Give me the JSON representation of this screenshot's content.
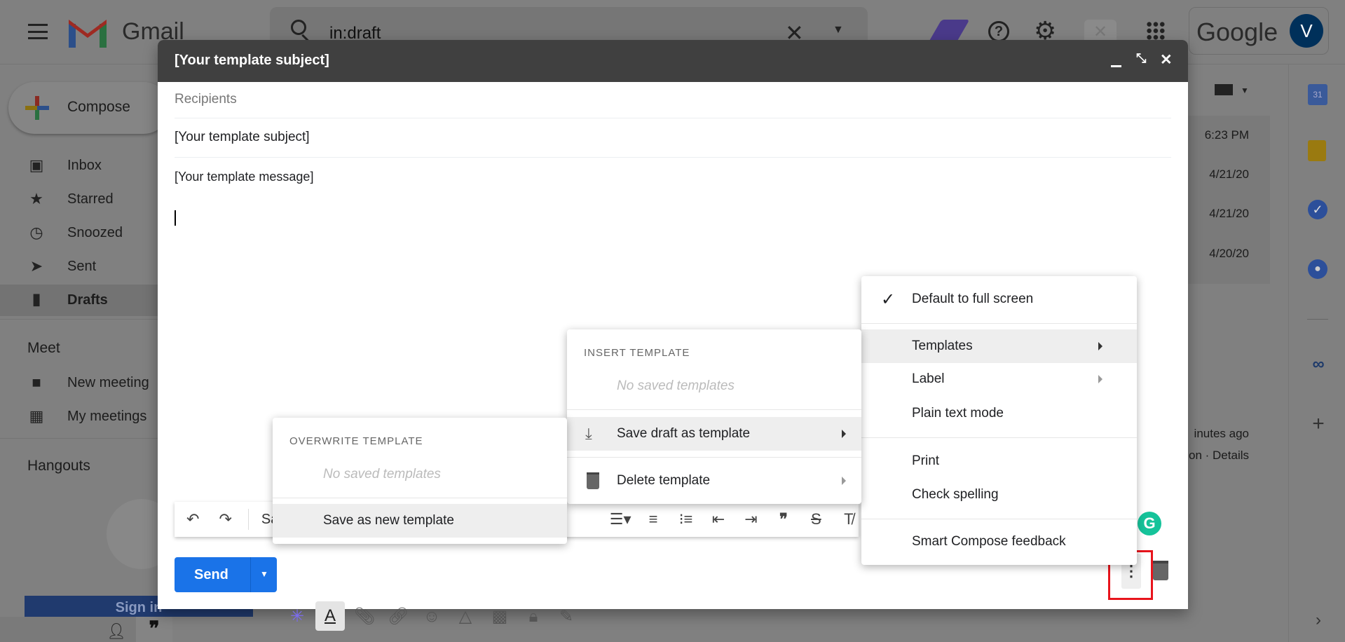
{
  "header": {
    "app_name": "Gmail",
    "search_value": "in:draft",
    "google_label": "Google",
    "avatar_letter": "V"
  },
  "sidebar": {
    "compose_label": "Compose",
    "items": [
      {
        "label": "Inbox"
      },
      {
        "label": "Starred"
      },
      {
        "label": "Snoozed"
      },
      {
        "label": "Sent"
      },
      {
        "label": "Drafts",
        "selected": true
      }
    ],
    "meet_heading": "Meet",
    "meet_items": [
      {
        "label": "New meeting"
      },
      {
        "label": "My meetings"
      }
    ],
    "hangouts_heading": "Hangouts",
    "sign_in_label": "Sign in"
  },
  "list": {
    "dates": [
      "6:23 PM",
      "4/21/20",
      "4/21/20",
      "4/20/20"
    ],
    "activity": "inutes ago",
    "details": "on · Details"
  },
  "compose": {
    "title": "[Your template subject]",
    "recipients_placeholder": "Recipients",
    "subject": "[Your template subject]",
    "body": "[Your template message]",
    "send_label": "Send",
    "toolbar_font_partial": "Sa"
  },
  "more_menu": {
    "items": [
      {
        "label": "Default to full screen",
        "checked": true
      },
      {
        "label": "Templates",
        "submenu": true,
        "highlighted": true
      },
      {
        "label": "Label",
        "submenu": true
      },
      {
        "label": "Plain text mode"
      },
      {
        "label": "Print"
      },
      {
        "label": "Check spelling"
      },
      {
        "label": "Smart Compose feedback"
      }
    ]
  },
  "templates_menu": {
    "insert_heading": "INSERT TEMPLATE",
    "insert_empty": "No saved templates",
    "save_draft": "Save draft as template",
    "delete": "Delete template"
  },
  "save_menu": {
    "overwrite_heading": "OVERWRITE TEMPLATE",
    "overwrite_empty": "No saved templates",
    "save_new": "Save as new template"
  },
  "colors": {
    "send_blue": "#1a73e8",
    "header_dark": "#404040",
    "highlight_box": "#e8141c",
    "grammarly": "#15c39a"
  }
}
